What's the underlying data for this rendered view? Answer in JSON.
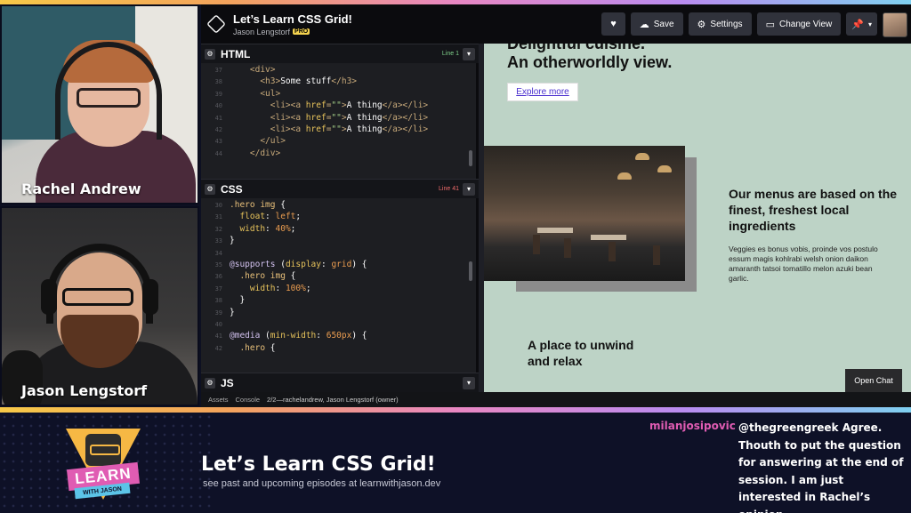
{
  "webcams": [
    {
      "name": "Rachel Andrew"
    },
    {
      "name": "Jason Lengstorf"
    }
  ],
  "codepen": {
    "title": "Let’s Learn CSS Grid!",
    "author": "Jason Lengstorf",
    "badge": "PRO",
    "buttons": {
      "heart_icon": "heart-icon",
      "save": "Save",
      "settings": "Settings",
      "change_view": "Change View",
      "pin_icon": "pin-icon"
    },
    "panes": {
      "html": {
        "name": "HTML",
        "line": "Line 1"
      },
      "css": {
        "name": "CSS",
        "line": "Line 41"
      },
      "js": {
        "name": "JS"
      }
    },
    "html_code": [
      {
        "n": "37",
        "parts": [
          [
            "c-tag",
            "    <div>"
          ]
        ]
      },
      {
        "n": "38",
        "parts": [
          [
            "c-tag",
            "      <h3>"
          ],
          [
            "c-txt",
            "Some stuff"
          ],
          [
            "c-tag",
            "</h3>"
          ]
        ]
      },
      {
        "n": "39",
        "parts": [
          [
            "c-tag",
            "      <ul>"
          ]
        ]
      },
      {
        "n": "40",
        "parts": [
          [
            "c-tag",
            "        <li><a "
          ],
          [
            "c-prop",
            "href"
          ],
          [
            "c-tag",
            "="
          ],
          [
            "c-str",
            "\"\""
          ],
          [
            "c-tag",
            ">"
          ],
          [
            "c-txt",
            "A thing"
          ],
          [
            "c-tag",
            "</a></li>"
          ]
        ]
      },
      {
        "n": "41",
        "parts": [
          [
            "c-tag",
            "        <li><a "
          ],
          [
            "c-prop",
            "href"
          ],
          [
            "c-tag",
            "="
          ],
          [
            "c-str",
            "\"\""
          ],
          [
            "c-tag",
            ">"
          ],
          [
            "c-txt",
            "A thing"
          ],
          [
            "c-tag",
            "</a></li>"
          ]
        ]
      },
      {
        "n": "42",
        "parts": [
          [
            "c-tag",
            "        <li><a "
          ],
          [
            "c-prop",
            "href"
          ],
          [
            "c-tag",
            "="
          ],
          [
            "c-str",
            "\"\""
          ],
          [
            "c-tag",
            ">"
          ],
          [
            "c-txt",
            "A thing"
          ],
          [
            "c-tag",
            "</a></li>"
          ]
        ]
      },
      {
        "n": "43",
        "parts": [
          [
            "c-tag",
            "      </ul>"
          ]
        ]
      },
      {
        "n": "44",
        "parts": [
          [
            "c-tag",
            "    </div>"
          ]
        ]
      }
    ],
    "css_code": [
      {
        "n": "30",
        "parts": [
          [
            "c-sel",
            ".hero img "
          ],
          [
            "c-txt",
            "{"
          ]
        ]
      },
      {
        "n": "31",
        "parts": [
          [
            "c-prop",
            "  float"
          ],
          [
            "c-txt",
            ": "
          ],
          [
            "c-val",
            "left"
          ],
          [
            "c-txt",
            ";"
          ]
        ]
      },
      {
        "n": "32",
        "parts": [
          [
            "c-prop",
            "  width"
          ],
          [
            "c-txt",
            ": "
          ],
          [
            "c-val",
            "40%"
          ],
          [
            "c-txt",
            ";"
          ]
        ]
      },
      {
        "n": "33",
        "parts": [
          [
            "c-txt",
            "}"
          ]
        ]
      },
      {
        "n": "34",
        "parts": [
          [
            "c-txt",
            ""
          ]
        ]
      },
      {
        "n": "35",
        "parts": [
          [
            "c-at",
            "@supports "
          ],
          [
            "c-txt",
            "("
          ],
          [
            "c-prop",
            "display"
          ],
          [
            "c-txt",
            ": "
          ],
          [
            "c-val",
            "grid"
          ],
          [
            "c-txt",
            ") {"
          ]
        ]
      },
      {
        "n": "36",
        "parts": [
          [
            "c-sel",
            "  .hero img "
          ],
          [
            "c-txt",
            "{"
          ]
        ]
      },
      {
        "n": "37",
        "parts": [
          [
            "c-prop",
            "    width"
          ],
          [
            "c-txt",
            ": "
          ],
          [
            "c-val",
            "100%"
          ],
          [
            "c-txt",
            ";"
          ]
        ]
      },
      {
        "n": "38",
        "parts": [
          [
            "c-txt",
            "  }"
          ]
        ]
      },
      {
        "n": "39",
        "parts": [
          [
            "c-txt",
            "}"
          ]
        ]
      },
      {
        "n": "40",
        "parts": [
          [
            "c-txt",
            ""
          ]
        ]
      },
      {
        "n": "41",
        "parts": [
          [
            "c-at",
            "@media "
          ],
          [
            "c-txt",
            "("
          ],
          [
            "c-prop",
            "min-width"
          ],
          [
            "c-txt",
            ": "
          ],
          [
            "c-val",
            "650px"
          ],
          [
            "c-txt",
            ") {"
          ]
        ]
      },
      {
        "n": "42",
        "parts": [
          [
            "c-sel",
            "  .hero "
          ],
          [
            "c-txt",
            "{"
          ]
        ]
      }
    ],
    "preview": {
      "heading_top": "Delightful cuisine.",
      "heading_bottom": "An otherworldly view.",
      "explore_btn": "Explore more",
      "menu_title": "Our menus are based on the finest, freshest local ingredients",
      "menu_body": "Veggies es bonus vobis, proinde vos postulo essum magis kohlrabi welsh onion daikon amaranth tatsoi tomatillo melon azuki bean garlic.",
      "place_text": "A place to unwind and relax"
    },
    "open_chat": "Open Chat",
    "footer": {
      "assets": "Assets",
      "console": "Console",
      "info": "2/2—rachelandrew, Jason Lengstorf (owner)"
    }
  },
  "stream": {
    "logo_learn": "LEARN",
    "logo_with": "WITH JASON",
    "title": "Let’s Learn CSS Grid!",
    "subtitle": "see past and upcoming episodes at learnwithjason.dev",
    "chat_user": "milanjosipovic",
    "chat_message": "@thegreengreek Agree. Thouth to put the question for answering at the end of session. I am just interested in Rachel’s opinion."
  },
  "colors": {
    "chat_user": "#e05cb3",
    "preview_bg": "#bdd3c6",
    "band_bg": "#0e1127"
  }
}
